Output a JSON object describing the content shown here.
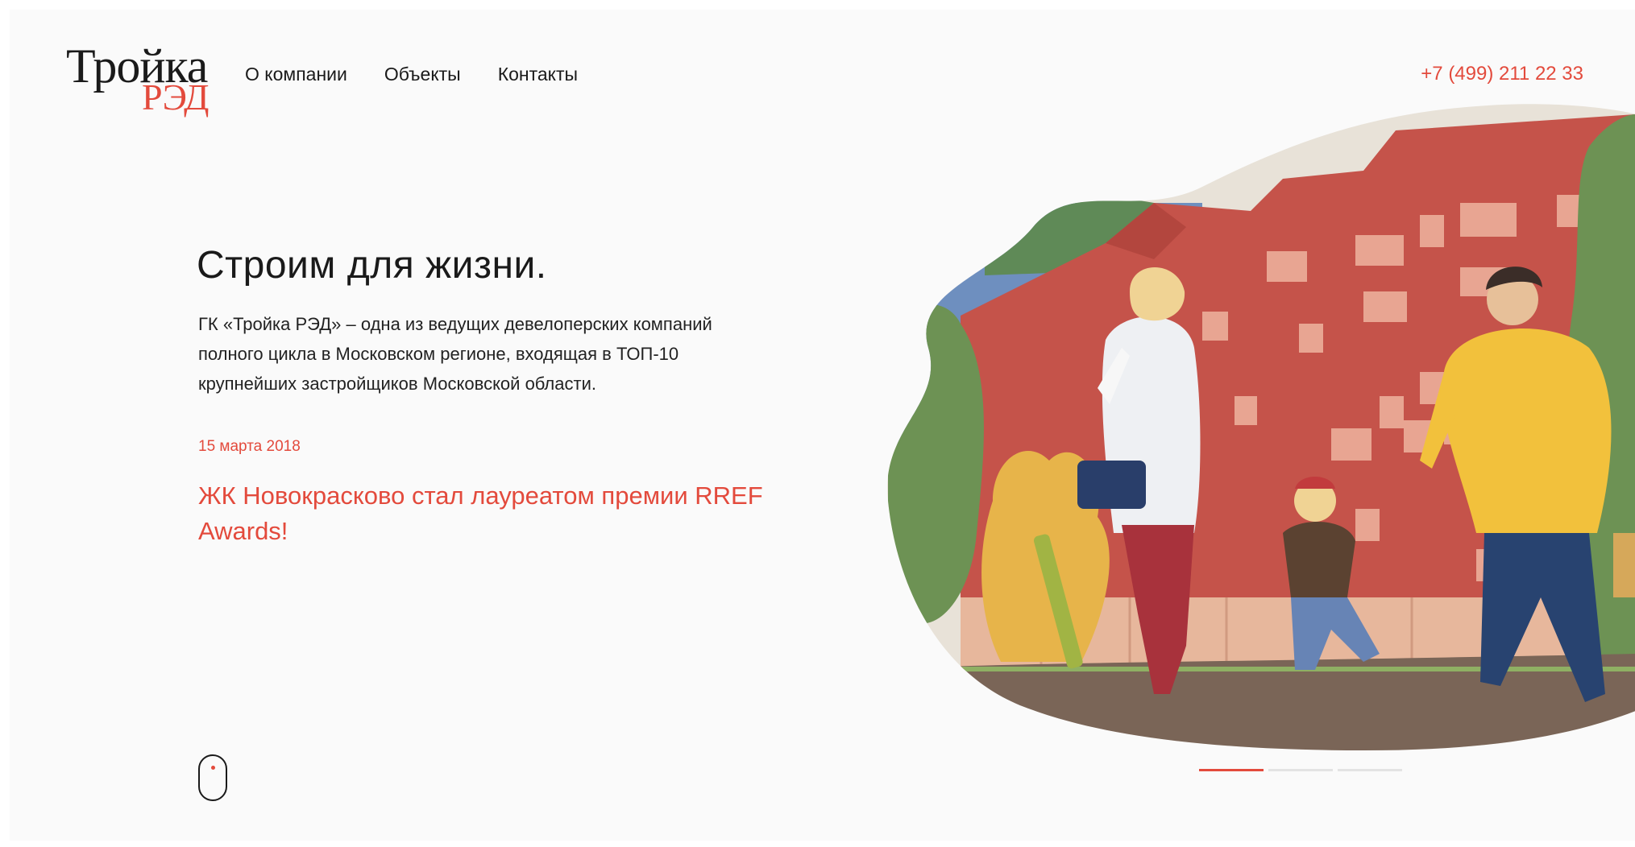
{
  "logo": {
    "main": "Тройка",
    "sub": "РЭД"
  },
  "nav": {
    "items": [
      {
        "label": "О компании"
      },
      {
        "label": "Объекты"
      },
      {
        "label": "Контакты"
      }
    ]
  },
  "header": {
    "phone": "+7 (499) 211 22 33"
  },
  "hero": {
    "title": "Строим для жизни.",
    "description": "ГК «Тройка РЭД» – одна из ведущих девелоперских компаний полного цикла в Московском регионе, входящая в ТОП-10 крупнейших застройщиков Московской области."
  },
  "news": {
    "date": "15 марта 2018",
    "headline": "ЖК Новокрасково стал лауреатом премии RREF Awards!"
  },
  "slider": {
    "count": 3,
    "active_index": 0
  },
  "colors": {
    "accent": "#e34a3c",
    "text": "#1a1a1a",
    "background": "#fafafa",
    "building": "#c5534a",
    "tree": "#6d9254",
    "sky": "#6e8fbf"
  },
  "icons": {
    "scroll": "mouse-scroll-icon"
  }
}
